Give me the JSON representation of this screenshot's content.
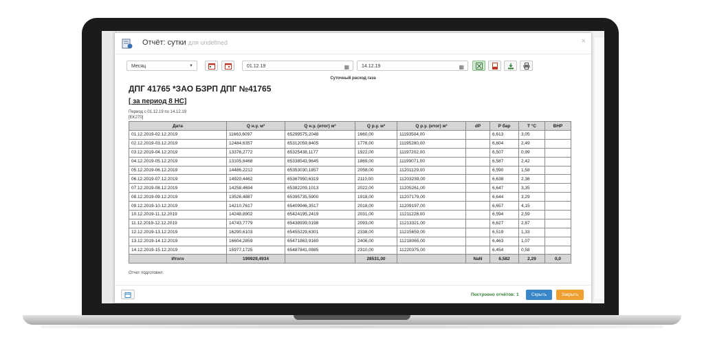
{
  "window": {
    "title": "Отчёт: сутки",
    "subtitle": "для undefined",
    "close": "×"
  },
  "toolbar": {
    "period_select": "Месяц",
    "date_from": "01.12.19",
    "date_to": "14.12.19"
  },
  "report": {
    "chart_subtitle": "Суточный расход газа",
    "title": "ДПГ 41765 *ЗАО БЗРП ДПГ №41765",
    "period_link": "[ за период 8 НС]",
    "period_text": "Период с 01.12.19 по 14.12.19",
    "code": "[EK270]",
    "columns": [
      "Дата",
      "Q н.у. м³",
      "Q н.у. (итог) м³",
      "Q р.у. м³",
      "Q р.у. (итог) м³",
      "dP",
      "Р бар",
      "Т °С",
      "ВНР"
    ],
    "rows": [
      [
        "01.12.2019-02.12.2019",
        "11663,6097",
        "65299575,2048",
        "1660,00",
        "11193504,00",
        "",
        "6,613",
        "3,05",
        ""
      ],
      [
        "02.12.2019-03.12.2019",
        "12484,6357",
        "65312059,8405",
        "1776,00",
        "11195280,00",
        "",
        "6,604",
        "2,49",
        ""
      ],
      [
        "03.12.2019-04.12.2019",
        "13378,2772",
        "65325438,1177",
        "1922,00",
        "11197202,00",
        "",
        "6,507",
        "0,99",
        ""
      ],
      [
        "04.12.2019-05.12.2019",
        "13105,8468",
        "65338543,9645",
        "1869,00",
        "11199071,00",
        "",
        "6,587",
        "2,42",
        ""
      ],
      [
        "05.12.2019-06.12.2019",
        "14486,2212",
        "65353030,1857",
        "2058,00",
        "11201129,00",
        "",
        "6,590",
        "1,58",
        ""
      ],
      [
        "06.12.2019-07.12.2019",
        "14920,4462",
        "65367950,6319",
        "2110,00",
        "11203239,00",
        "",
        "6,638",
        "2,36",
        ""
      ],
      [
        "07.12.2019-08.12.2019",
        "14258,4694",
        "65382209,1013",
        "2022,00",
        "11205261,00",
        "",
        "6,647",
        "3,35",
        ""
      ],
      [
        "08.12.2019-09.12.2019",
        "13526,4887",
        "65395735,5900",
        "1918,00",
        "11207179,00",
        "",
        "6,644",
        "3,29",
        ""
      ],
      [
        "09.12.2019-10.12.2019",
        "14210,7617",
        "65409946,3517",
        "2018,00",
        "11209197,00",
        "",
        "6,657",
        "4,15",
        ""
      ],
      [
        "10.12.2019-11.12.2019",
        "14248,8902",
        "65424195,2419",
        "2031,00",
        "11211228,00",
        "",
        "6,594",
        "2,59",
        ""
      ],
      [
        "11.12.2019-12.12.2019",
        "14743,7779",
        "65438939,0198",
        "2093,00",
        "11213321,00",
        "",
        "6,627",
        "2,87",
        ""
      ],
      [
        "12.12.2019-13.12.2019",
        "16290,6103",
        "65455229,6301",
        "2338,00",
        "11215659,00",
        "",
        "6,519",
        "1,33",
        ""
      ],
      [
        "13.12.2019-14.12.2019",
        "16604,2859",
        "65471863,9160",
        "2406,00",
        "11218065,00",
        "",
        "6,463",
        "1,07",
        ""
      ],
      [
        "14.12.2019-15.12.2019",
        "15977,1725",
        "65487841,0885",
        "2310,00",
        "11220375,00",
        "",
        "6,454",
        "0,58",
        ""
      ]
    ],
    "total": [
      "Итого",
      "199929,4934",
      "",
      "28531,00",
      "",
      "NaN",
      "6,582",
      "2,29",
      "0,0"
    ],
    "prepared_by": "Отчет подготовил:"
  },
  "footer": {
    "built_text": "Построено отчётов: 1",
    "hide_button": "Скрыть",
    "close_button": "Закрыть"
  }
}
